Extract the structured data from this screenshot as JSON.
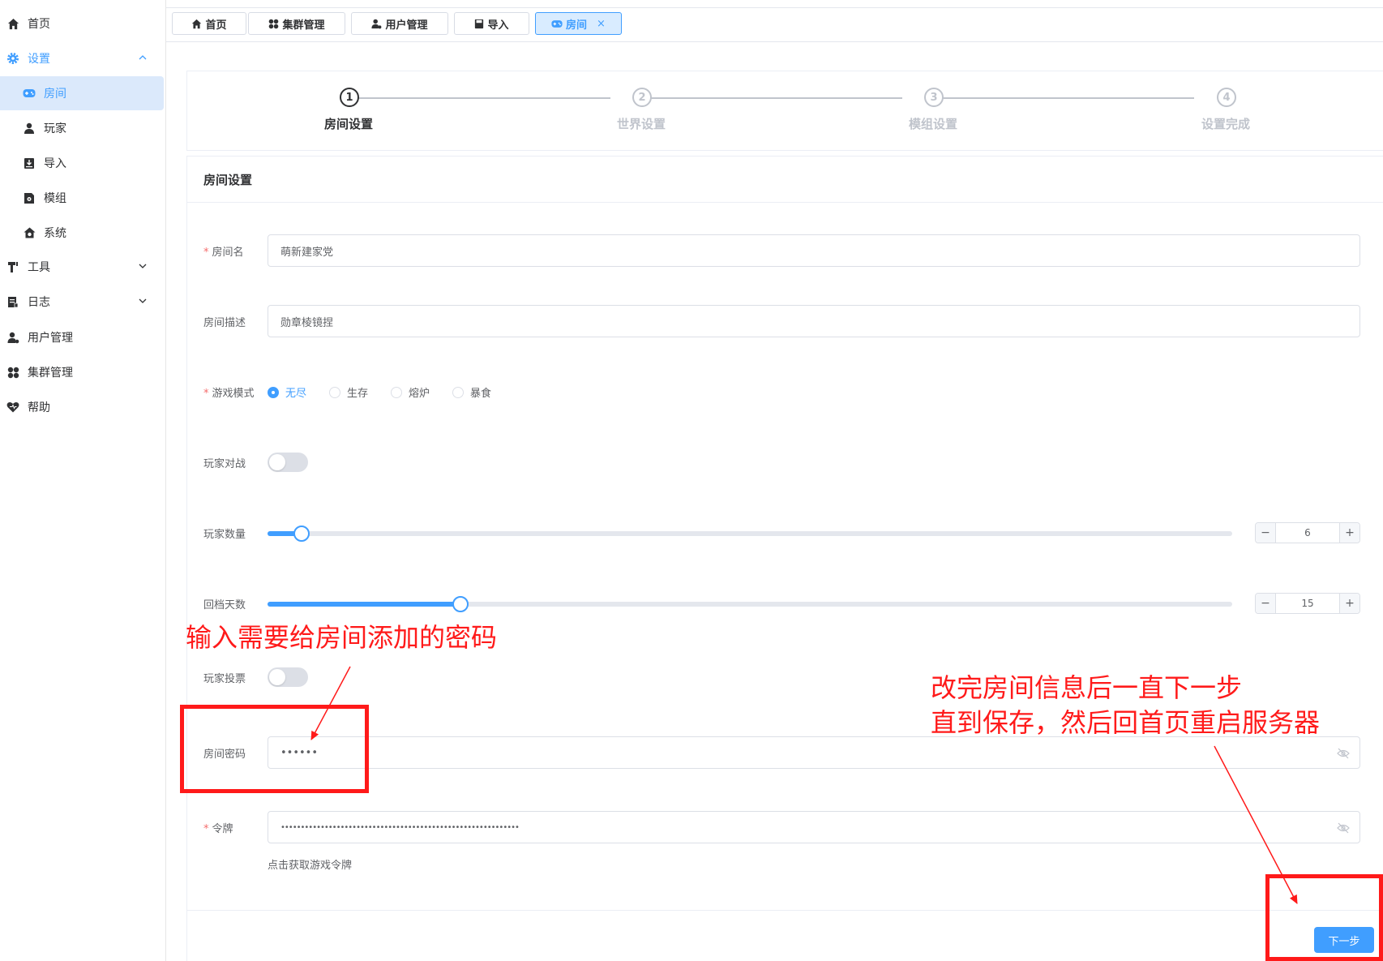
{
  "sidebar": {
    "items": [
      {
        "label": "首页",
        "icon": "home-icon"
      },
      {
        "label": "设置",
        "icon": "gear-icon"
      },
      {
        "label": "房间",
        "icon": "gamepad-icon"
      },
      {
        "label": "玩家",
        "icon": "user-icon"
      },
      {
        "label": "导入",
        "icon": "import-icon"
      },
      {
        "label": "模组",
        "icon": "mod-icon"
      },
      {
        "label": "系统",
        "icon": "system-icon"
      },
      {
        "label": "工具",
        "icon": "tools-icon"
      },
      {
        "label": "日志",
        "icon": "log-icon"
      },
      {
        "label": "用户管理",
        "icon": "user-manage-icon"
      },
      {
        "label": "集群管理",
        "icon": "cluster-icon"
      },
      {
        "label": "帮助",
        "icon": "help-icon"
      }
    ]
  },
  "tabs": [
    {
      "label": "首页"
    },
    {
      "label": "集群管理"
    },
    {
      "label": "用户管理"
    },
    {
      "label": "导入"
    },
    {
      "label": "房间",
      "close": "×"
    }
  ],
  "steps": [
    {
      "num": "1",
      "title": "房间设置"
    },
    {
      "num": "2",
      "title": "世界设置"
    },
    {
      "num": "3",
      "title": "模组设置"
    },
    {
      "num": "4",
      "title": "设置完成"
    }
  ],
  "form": {
    "card_title": "房间设置",
    "room_name": {
      "label": "房间名",
      "value": "萌新建家党"
    },
    "room_desc": {
      "label": "房间描述",
      "value": "勋章棱镜捏"
    },
    "game_mode": {
      "label": "游戏模式",
      "options": [
        "无尽",
        "生存",
        "熔炉",
        "暴食"
      ],
      "selected": "无尽"
    },
    "pvp": {
      "label": "玩家对战",
      "on": false
    },
    "player_count": {
      "label": "玩家数量",
      "value": "6",
      "fraction": 0.035
    },
    "rollback_days": {
      "label": "回档天数",
      "value": "15",
      "fraction": 0.2
    },
    "player_vote": {
      "label": "玩家投票",
      "on": false
    },
    "room_password": {
      "label": "房间密码",
      "value": "••••••"
    },
    "token": {
      "label": "令牌",
      "value": "••••••••••••••••••••••••••••••••••••••••••••••••••••••••••••"
    },
    "token_link": "点击获取游戏令牌",
    "next_button": "下一步"
  },
  "annotations": {
    "password_note": "输入需要给房间添加的密码",
    "next_note_line1": "改完房间信息后一直下一步",
    "next_note_line2": "直到保存，然后回首页重启服务器",
    "color": "#ff1a1a"
  },
  "colors": {
    "accent": "#409eff",
    "required": "#f56c6c"
  }
}
